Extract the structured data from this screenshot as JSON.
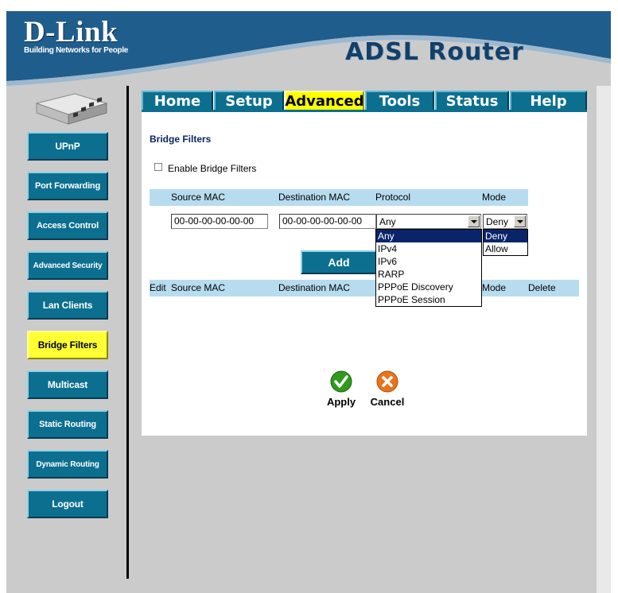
{
  "header": {
    "brand": "D-Link",
    "tagline": "Building Networks for People",
    "product": "ADSL Router"
  },
  "tabs": [
    {
      "label": "Home"
    },
    {
      "label": "Setup"
    },
    {
      "label": "Advanced",
      "active": true
    },
    {
      "label": "Tools"
    },
    {
      "label": "Status"
    },
    {
      "label": "Help"
    }
  ],
  "sidebar": {
    "items": [
      {
        "label": "UPnP"
      },
      {
        "label": "Port Forwarding"
      },
      {
        "label": "Access Control"
      },
      {
        "label": "Advanced Security"
      },
      {
        "label": "Lan Clients"
      },
      {
        "label": "Bridge Filters",
        "active": true
      },
      {
        "label": "Multicast"
      },
      {
        "label": "Static Routing"
      },
      {
        "label": "Dynamic Routing"
      },
      {
        "label": "Logout"
      }
    ]
  },
  "main": {
    "title": "Bridge Filters",
    "enable_label": "Enable Bridge Filters",
    "enable_checked": false,
    "form_headers": {
      "source_mac": "Source MAC",
      "dest_mac": "Destination MAC",
      "protocol": "Protocol",
      "mode": "Mode"
    },
    "source_mac_value": "00-00-00-00-00-00",
    "dest_mac_value": "00-00-00-00-00-00",
    "protocol_value": "Any",
    "mode_value": "Deny",
    "protocol_options": [
      "Any",
      "IPv4",
      "IPv6",
      "RARP",
      "PPPoE Discovery",
      "PPPoE Session"
    ],
    "mode_options": [
      "Deny",
      "Allow"
    ],
    "add_label": "Add",
    "list_headers": {
      "edit": "Edit",
      "source_mac": "Source MAC",
      "dest_mac": "Destination MAC",
      "mode": "Mode",
      "delete": "Delete"
    },
    "apply_label": "Apply",
    "cancel_label": "Cancel"
  },
  "colors": {
    "accent_blue": "#0c6f8f",
    "active_yellow": "#ffff33",
    "header_row": "#b8dcef",
    "header_wave": "#1f5d8c"
  }
}
